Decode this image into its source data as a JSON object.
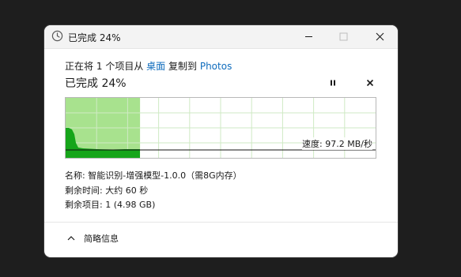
{
  "window": {
    "title": "已完成 24%",
    "icon": "clock-icon"
  },
  "transfer": {
    "prefix": "正在将",
    "item_count": "1",
    "items_word": "个项目从",
    "source": "桌面",
    "copy_to": "复制到",
    "destination": "Photos"
  },
  "progress": {
    "title": "已完成 24%",
    "percent": 24,
    "pause_icon": "pause-icon",
    "cancel_icon": "close-icon",
    "fill_color": "#a8e28e",
    "speed_color": "#16a51a"
  },
  "speed": {
    "label": "速度:",
    "value": "97.2 MB/秒"
  },
  "details": {
    "name_label": "名称:",
    "name_value": "智能识别-增强模型-1.0.0（需8G内存）",
    "time_label": "剩余时间:",
    "time_value": "大约 60 秒",
    "items_label": "剩余项目:",
    "items_value": "1 (4.98 GB)"
  },
  "footer": {
    "toggle_label": "简略信息",
    "toggle_icon": "chevron-up-icon"
  }
}
